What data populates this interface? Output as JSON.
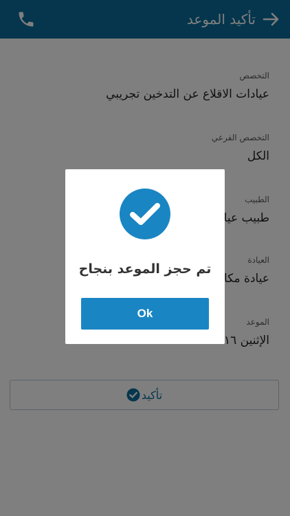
{
  "app_bar": {
    "title": "تأكيد الموعد",
    "back_icon": "arrow-right-icon",
    "phone_icon": "phone-icon"
  },
  "fields": [
    {
      "label": "التخصص",
      "value": "عيادات الاقلاع عن التدخين تجريبي"
    },
    {
      "label": "التخصص الفرعي",
      "value": "الكل"
    },
    {
      "label": "الطبيب",
      "value": "طبيب عيا"
    },
    {
      "label": "العيادة",
      "value": "عيادة مكا"
    },
    {
      "label": "الموعد",
      "value": "الإثنين ١٦"
    }
  ],
  "confirm_button": {
    "label": "تأكيد",
    "icon": "check-circle-icon"
  },
  "dialog": {
    "icon": "check-circle-icon",
    "message": "تم حجز الموعد بنجاح",
    "ok_label": "Ok"
  },
  "colors": {
    "primary": "#0a6d9a",
    "dialog_button": "#1a85c3",
    "overlay": "rgba(0,0,0,0.5)"
  }
}
